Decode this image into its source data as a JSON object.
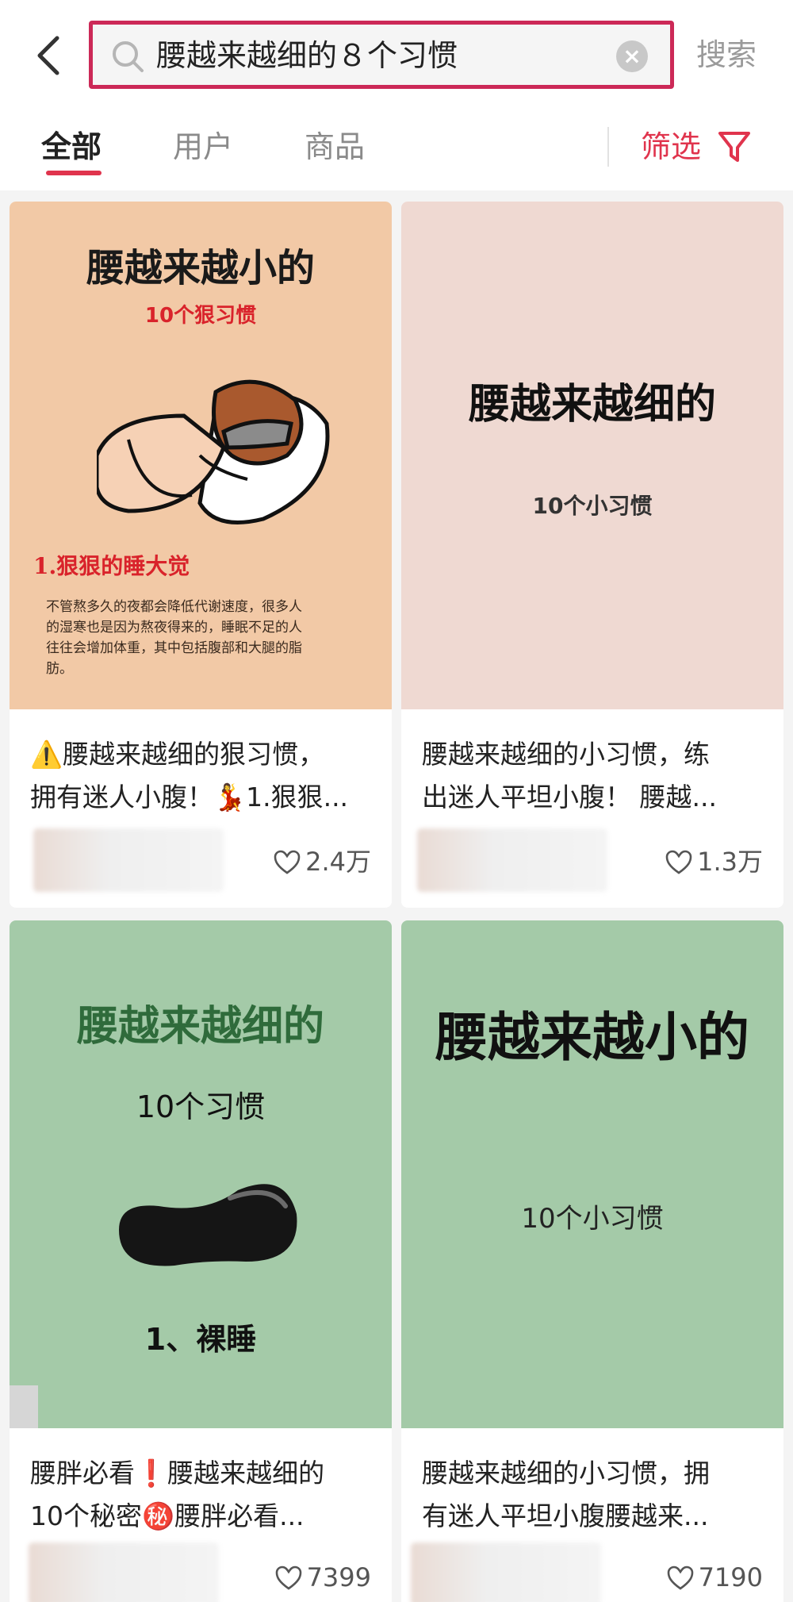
{
  "search": {
    "query": "腰越来越细的８个习惯",
    "submit_label": "搜索"
  },
  "tabs": [
    {
      "label": "全部",
      "active": true
    },
    {
      "label": "用户",
      "active": false
    },
    {
      "label": "商品",
      "active": false
    }
  ],
  "filter": {
    "label": "筛选",
    "icon": "funnel-icon"
  },
  "colors": {
    "accent": "#e0344d",
    "highlight_border": "#cc2957"
  },
  "cards": [
    {
      "cover": {
        "heading": "腰越来越小的",
        "subheading": "10个狠习惯",
        "point": "1.狠狠的睡大觉",
        "body_lines": [
          "不管熬多久的夜都会降低代谢速度，很多人",
          "的湿寒也是因为熬夜得来的，睡眠不足的人",
          "往往会增加体重，其中包括腹部和大腿的脂",
          "肪。"
        ],
        "background": "#f2c9a6"
      },
      "title_line1": "⚠️腰越来越细的狠习惯，",
      "title_line2": "拥有迷人小腹！💃1.狠狠...",
      "likes": "2.4万"
    },
    {
      "cover": {
        "heading": "腰越来越细的",
        "subheading": "10个小习惯",
        "background": "#efd9d2"
      },
      "title_line1": "腰越来越细的小习惯，练",
      "title_line2": "出迷人平坦小腹！ 腰越...",
      "likes": "1.3万"
    },
    {
      "cover": {
        "heading": "腰越来越细的",
        "subheading": "10个习惯",
        "point": "1、裸睡",
        "background": "#a4caa8"
      },
      "title_line1": "腰胖必看❗腰越来越细的",
      "title_line2": "10个秘密㊙️腰胖必看...",
      "likes": "7399"
    },
    {
      "cover": {
        "heading": "腰越来越小的",
        "subheading": "10个小习惯",
        "background": "#a4caa8"
      },
      "title_line1": "腰越来越细的小习惯，拥",
      "title_line2": "有迷人平坦小腹腰越来...",
      "likes": "7190"
    }
  ]
}
